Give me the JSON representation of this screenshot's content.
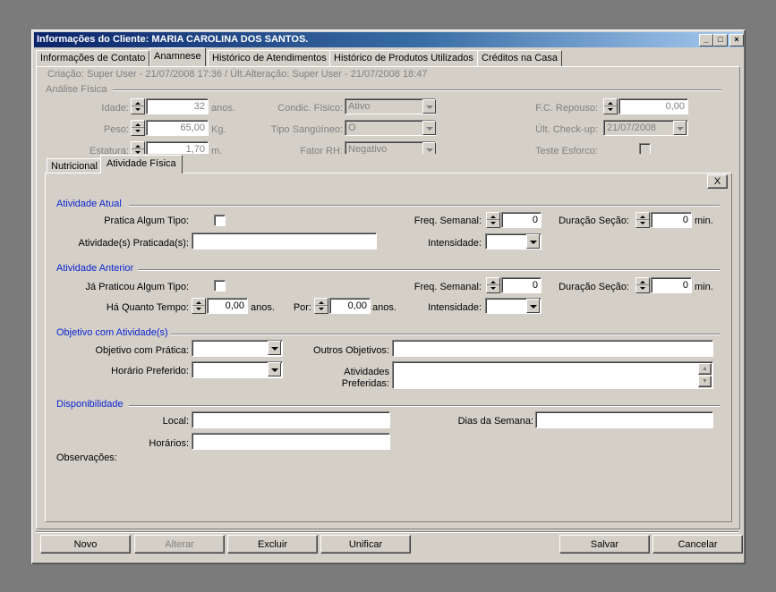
{
  "window": {
    "title": "Informações do Cliente: MARIA CAROLINA DOS SANTOS."
  },
  "main_tabs": [
    "Informações de Contato",
    "Anamnese",
    "Histórico de Atendimentos",
    "Histórico de Produtos Utilizados",
    "Créditos na Casa"
  ],
  "meta": {
    "created": "Criação: Super User - 21/07/2008 17:36  / Últ.Alteração: Super User - 21/07/2008 18:47"
  },
  "analise": {
    "title": "Análise Física",
    "idade_label": "Idade:",
    "idade": "32",
    "idade_unit": "anos.",
    "peso_label": "Peso:",
    "peso": "65,00",
    "peso_unit": "Kg.",
    "estatura_label": "Estatura:",
    "estatura": "1,70",
    "estatura_unit": "m.",
    "condic_label": "Condic. Físico:",
    "condic": "Ativo",
    "sangue_label": "Tipo Sangüíneo:",
    "sangue": "O",
    "rh_label": "Fator RH:",
    "rh": "Negativo",
    "fc_label": "F.C. Repouso:",
    "fc": "0,00",
    "checkup_label": "Últ. Check-up:",
    "checkup": "21/07/2008",
    "teste_label": "Teste Esforço:"
  },
  "sub_tabs": [
    "Nutricional",
    "Atividade Física"
  ],
  "close_btn": "X",
  "atual": {
    "title": "Atividade Atual",
    "pratica_label": "Pratica Algum Tipo:",
    "praticadas_label": "Atividade(s) Praticada(s):",
    "praticadas": "",
    "freq_label": "Freq. Semanal:",
    "freq": "0",
    "duracao_label": "Duração Seção:",
    "duracao": "0",
    "duracao_unit": "min.",
    "intensidade_label": "Intensidade:",
    "intensidade": ""
  },
  "anterior": {
    "title": "Atividade Anterior",
    "ja_label": "Já Praticou Algum Tipo:",
    "quanto_label": "Há Quanto Tempo:",
    "quanto": "0,00",
    "quanto_unit": "anos.",
    "por_label": "Por:",
    "por": "0,00",
    "por_unit": "anos.",
    "freq_label": "Freq. Semanal:",
    "freq": "0",
    "duracao_label": "Duração Seção:",
    "duracao": "0",
    "duracao_unit": "min.",
    "intensidade_label": "Intensidade:",
    "intensidade": ""
  },
  "objetivo": {
    "title": "Objetivo com Atividade(s)",
    "pratica_label": "Objetivo com Prática:",
    "pratica": "",
    "horario_label": "Horário Preferido:",
    "horario": "",
    "outros_label": "Outros Objetivos:",
    "outros": "",
    "preferidas_label1": "Atividades",
    "preferidas_label2": "Preferidas:",
    "preferidas": ""
  },
  "disp": {
    "title": "Disponibilidade",
    "local_label": "Local:",
    "local": "",
    "horarios_label": "Horários:",
    "horarios": "",
    "dias_label": "Dias da Semana:",
    "dias": "",
    "obs_label": "Observações:"
  },
  "buttons": {
    "novo": "Novo",
    "alterar": "Alterar",
    "excluir": "Excluir",
    "unificar": "Unificar",
    "salvar": "Salvar",
    "cancelar": "Cancelar"
  }
}
